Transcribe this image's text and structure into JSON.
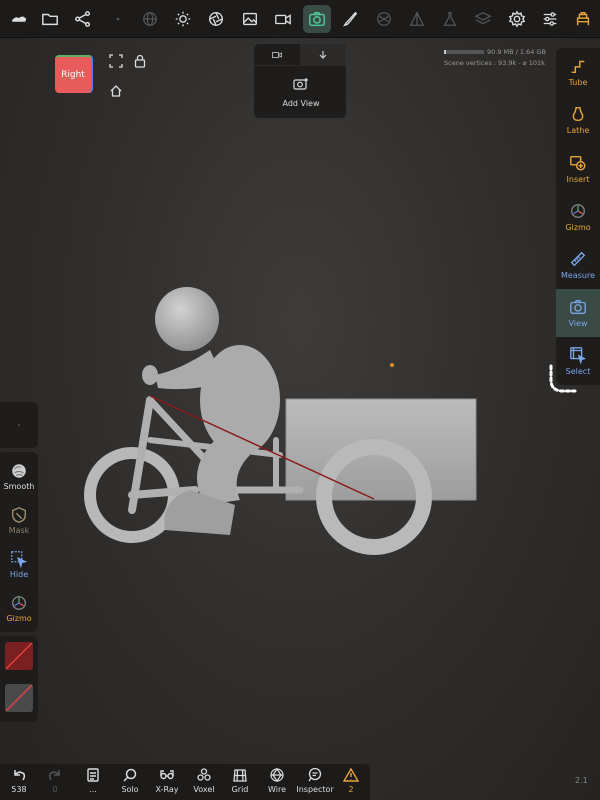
{
  "colors": {
    "accent_orange": "#e8a33a",
    "accent_green": "#4fc99a",
    "accent_blue": "#7aa6e8",
    "panel_bg": "#1e1d1c",
    "active_bg": "#3a4a44",
    "model": "#a9a9a9",
    "stroke_line": "#8b1a1a"
  },
  "topbar": {
    "icons": [
      "sculpt-logo-icon",
      "folder-icon",
      "scene-graph-icon",
      "dot-icon",
      "globe-icon",
      "sun-icon",
      "aperture-icon",
      "image-icon",
      "video-icon",
      "camera-view-icon",
      "brush-icon",
      "sphere-icon",
      "prism-icon",
      "flask-icon",
      "layers-icon",
      "gear-icon",
      "sliders-icon",
      "tools-icon"
    ]
  },
  "viewcube": {
    "face_label": "Right"
  },
  "add_view_panel": {
    "add_label": "Add View"
  },
  "stats": {
    "memory": "90.9 MB / 1.64 GB",
    "memory_fraction": 0.06,
    "vertices": "Scene vertices : 93.9k - ",
    "faces": "101k"
  },
  "right_panel": {
    "items": [
      {
        "label": "Tube",
        "icon": "tube-icon"
      },
      {
        "label": "Lathe",
        "icon": "lathe-icon"
      },
      {
        "label": "Insert",
        "icon": "insert-icon"
      },
      {
        "label": "Gizmo",
        "icon": "gizmo-icon"
      },
      {
        "label": "Measure",
        "icon": "ruler-icon"
      },
      {
        "label": "View",
        "icon": "camera-icon"
      },
      {
        "label": "Select",
        "icon": "select-icon"
      }
    ],
    "active_label": "View"
  },
  "left_panel": {
    "items": [
      {
        "label": "Smooth",
        "icon": "smooth-icon"
      },
      {
        "label": "Mask",
        "icon": "mask-icon"
      },
      {
        "label": "Hide",
        "icon": "hide-icon"
      },
      {
        "label": "Gizmo",
        "icon": "gizmo-icon"
      }
    ]
  },
  "bottombar": {
    "items": [
      {
        "label": "538",
        "icon": "undo-icon"
      },
      {
        "label": "0",
        "icon": "redo-icon"
      },
      {
        "label": "...",
        "icon": "history-icon"
      },
      {
        "label": "Solo",
        "icon": "solo-icon"
      },
      {
        "label": "X-Ray",
        "icon": "xray-icon"
      },
      {
        "label": "Voxel",
        "icon": "voxel-icon"
      },
      {
        "label": "Grid",
        "icon": "grid-icon"
      },
      {
        "label": "Wire",
        "icon": "wire-icon"
      },
      {
        "label": "Inspector",
        "icon": "inspector-icon"
      },
      {
        "label": "2",
        "icon": "warning-icon"
      }
    ]
  },
  "version": "2.1"
}
